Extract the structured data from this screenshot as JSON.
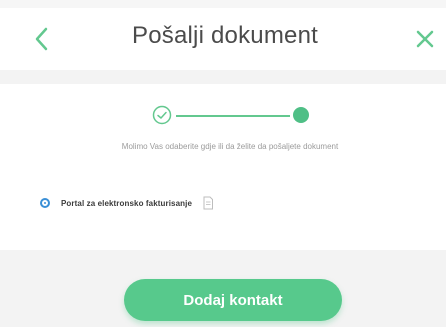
{
  "header": {
    "title": "Pošalji dokument",
    "back_icon": "chevron-left-icon",
    "close_icon": "close-icon"
  },
  "stepper": {
    "steps_total": 2,
    "current_step": 2,
    "completed_icon": "check-circle-icon"
  },
  "instruction": "Molimo Vas odaberite gdje ili da želite da pošaljete dokument",
  "option": {
    "label": "Portal za elektronsko fakturisanje",
    "selected": true,
    "icon": "document-icon"
  },
  "actions": {
    "primary_label": "Dodaj kontakt"
  },
  "colors": {
    "accent_green": "#57c98c",
    "radio_blue": "#3a8fd6",
    "title_text": "#4b4b4b",
    "muted_text": "#9b9b9b",
    "background": "#f3f3f3"
  }
}
